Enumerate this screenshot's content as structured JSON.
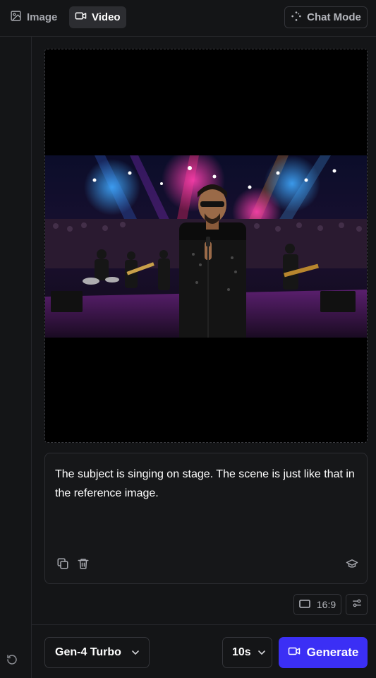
{
  "tabs": {
    "image_label": "Image",
    "video_label": "Video",
    "active": "Video"
  },
  "chat_mode": {
    "label": "Chat Mode"
  },
  "media": {
    "description_icon": "concert-stage-photo"
  },
  "prompt": {
    "text": "The subject is singing on stage. The scene is just like that in the reference image.",
    "icons": [
      "copy-icon",
      "trash-icon",
      "graduation-cap-icon"
    ]
  },
  "aspect_ratio": {
    "label": "16:9"
  },
  "model": {
    "selected": "Gen-4 Turbo"
  },
  "duration": {
    "selected": "10s"
  },
  "generate": {
    "label": "Generate"
  },
  "colors": {
    "background": "#141517",
    "accent": "#3b2ff5",
    "border": "#34353a"
  }
}
